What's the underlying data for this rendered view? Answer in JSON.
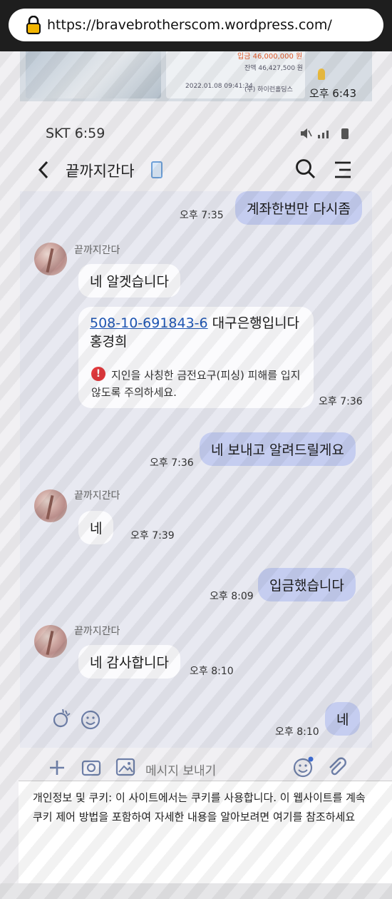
{
  "browser": {
    "url": "https://bravebrotherscom.wordpress.com/"
  },
  "prev_screenshot": {
    "amount": "입금 46,000,000 원",
    "balance": "잔액 46,427,500 원",
    "timestamp": "2022.01.08 09:41:34",
    "company": "(주) 하이런홀딩스",
    "time": "오후 6:43"
  },
  "status": {
    "carrier_time": "SKT 6:59"
  },
  "header": {
    "title": "끝까지간다"
  },
  "messages": [
    {
      "dir": "out",
      "text": "계좌한번만 다시좀",
      "time": "오후 7:35"
    },
    {
      "dir": "in",
      "sender": "끝까지간다",
      "text": "네 알겟습니다"
    },
    {
      "dir": "in",
      "account": "508-10-691843-6",
      "text": " 대구은행입니다",
      "text2": "홍경희",
      "warning": "지인을 사칭한 금전요구(피싱) 피해를 입지 않도록 주의하세요.",
      "time": "오후 7:36"
    },
    {
      "dir": "out",
      "text": "네 보내고 알려드릴게요",
      "time": "오후 7:36"
    },
    {
      "dir": "in",
      "sender": "끝까지간다",
      "text": "네",
      "time": "오후 7:39"
    },
    {
      "dir": "out",
      "text": "입금했습니다",
      "time": "오후 8:09"
    },
    {
      "dir": "in",
      "sender": "끝까지간다",
      "text": "네 감사합니다",
      "time": "오후 8:10"
    },
    {
      "dir": "out",
      "text": "네",
      "time": "오후 8:10"
    }
  ],
  "input": {
    "placeholder": "메시지 보내기"
  },
  "cookie": {
    "line1": "개인정보 및 쿠키: 이 사이트에서는 쿠키를 사용합니다. 이 웹사이트를 계속",
    "line2": "쿠키 제어 방법을 포함하여 자세한 내용을 알아보려면 여기를 참조하세요"
  },
  "colors": {
    "outgoing_bubble": "#c5cdf0",
    "incoming_bubble": "#fbfbfd",
    "warning_icon": "#e1393d",
    "link": "#1f56b3"
  }
}
